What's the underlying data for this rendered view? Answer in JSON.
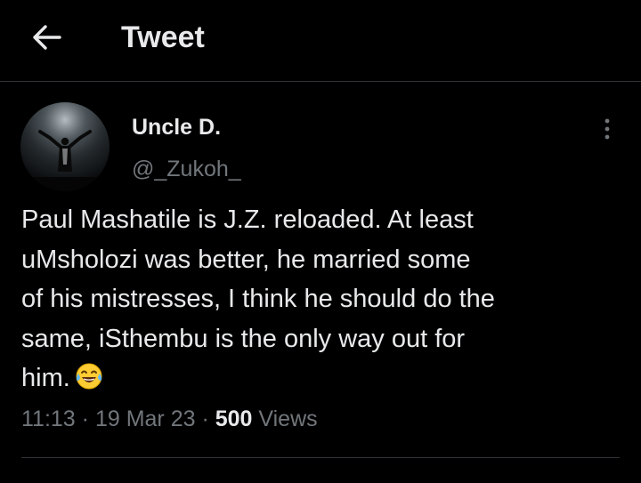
{
  "header": {
    "title": "Tweet",
    "back_icon": "arrow-left-icon"
  },
  "author": {
    "name": "Uncle D.",
    "handle": "@_Zukoh_",
    "avatar_icon": "avatar-image"
  },
  "tweet": {
    "text_lines": [
      "Paul Mashatile is J.Z. reloaded. At least",
      "uMsholozi was better, he married some",
      "of his mistresses, I think he should do the",
      "same, iSthembu is the only way out for",
      "him."
    ],
    "emoji": "face-with-tears-of-joy-icon"
  },
  "meta": {
    "time": "11:13",
    "sep1": " · ",
    "date": "19 Mar 23",
    "sep2": " · ",
    "views_count": "500",
    "views_label": " Views"
  },
  "more_icon": "more-vertical-icon",
  "colors": {
    "background": "#000000",
    "text_primary": "#e7e9ea",
    "text_secondary": "#71767b",
    "divider": "#2f3336"
  }
}
